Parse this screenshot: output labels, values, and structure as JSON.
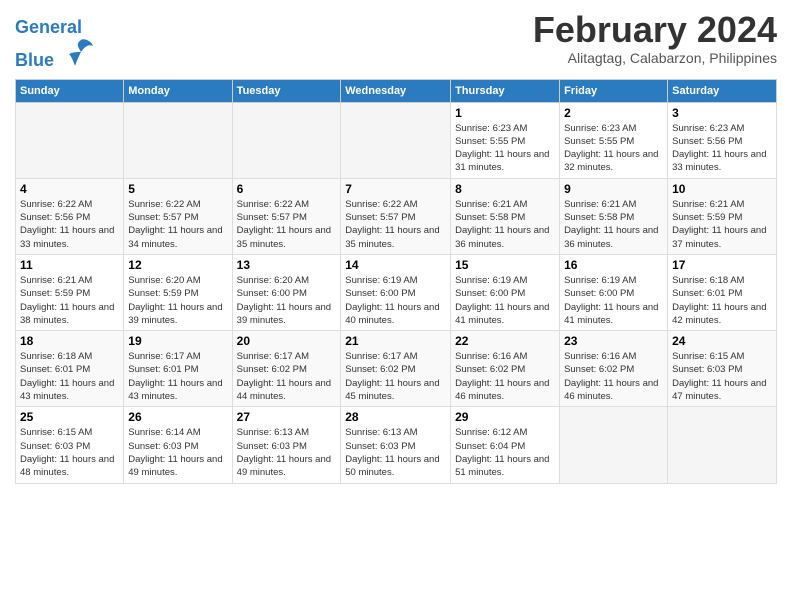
{
  "header": {
    "logo_line1": "General",
    "logo_line2": "Blue",
    "month": "February 2024",
    "location": "Alitagtag, Calabarzon, Philippines"
  },
  "days_of_week": [
    "Sunday",
    "Monday",
    "Tuesday",
    "Wednesday",
    "Thursday",
    "Friday",
    "Saturday"
  ],
  "weeks": [
    [
      {
        "day": "",
        "info": ""
      },
      {
        "day": "",
        "info": ""
      },
      {
        "day": "",
        "info": ""
      },
      {
        "day": "",
        "info": ""
      },
      {
        "day": "1",
        "info": "Sunrise: 6:23 AM\nSunset: 5:55 PM\nDaylight: 11 hours and 31 minutes."
      },
      {
        "day": "2",
        "info": "Sunrise: 6:23 AM\nSunset: 5:55 PM\nDaylight: 11 hours and 32 minutes."
      },
      {
        "day": "3",
        "info": "Sunrise: 6:23 AM\nSunset: 5:56 PM\nDaylight: 11 hours and 33 minutes."
      }
    ],
    [
      {
        "day": "4",
        "info": "Sunrise: 6:22 AM\nSunset: 5:56 PM\nDaylight: 11 hours and 33 minutes."
      },
      {
        "day": "5",
        "info": "Sunrise: 6:22 AM\nSunset: 5:57 PM\nDaylight: 11 hours and 34 minutes."
      },
      {
        "day": "6",
        "info": "Sunrise: 6:22 AM\nSunset: 5:57 PM\nDaylight: 11 hours and 35 minutes."
      },
      {
        "day": "7",
        "info": "Sunrise: 6:22 AM\nSunset: 5:57 PM\nDaylight: 11 hours and 35 minutes."
      },
      {
        "day": "8",
        "info": "Sunrise: 6:21 AM\nSunset: 5:58 PM\nDaylight: 11 hours and 36 minutes."
      },
      {
        "day": "9",
        "info": "Sunrise: 6:21 AM\nSunset: 5:58 PM\nDaylight: 11 hours and 36 minutes."
      },
      {
        "day": "10",
        "info": "Sunrise: 6:21 AM\nSunset: 5:59 PM\nDaylight: 11 hours and 37 minutes."
      }
    ],
    [
      {
        "day": "11",
        "info": "Sunrise: 6:21 AM\nSunset: 5:59 PM\nDaylight: 11 hours and 38 minutes."
      },
      {
        "day": "12",
        "info": "Sunrise: 6:20 AM\nSunset: 5:59 PM\nDaylight: 11 hours and 39 minutes."
      },
      {
        "day": "13",
        "info": "Sunrise: 6:20 AM\nSunset: 6:00 PM\nDaylight: 11 hours and 39 minutes."
      },
      {
        "day": "14",
        "info": "Sunrise: 6:19 AM\nSunset: 6:00 PM\nDaylight: 11 hours and 40 minutes."
      },
      {
        "day": "15",
        "info": "Sunrise: 6:19 AM\nSunset: 6:00 PM\nDaylight: 11 hours and 41 minutes."
      },
      {
        "day": "16",
        "info": "Sunrise: 6:19 AM\nSunset: 6:00 PM\nDaylight: 11 hours and 41 minutes."
      },
      {
        "day": "17",
        "info": "Sunrise: 6:18 AM\nSunset: 6:01 PM\nDaylight: 11 hours and 42 minutes."
      }
    ],
    [
      {
        "day": "18",
        "info": "Sunrise: 6:18 AM\nSunset: 6:01 PM\nDaylight: 11 hours and 43 minutes."
      },
      {
        "day": "19",
        "info": "Sunrise: 6:17 AM\nSunset: 6:01 PM\nDaylight: 11 hours and 43 minutes."
      },
      {
        "day": "20",
        "info": "Sunrise: 6:17 AM\nSunset: 6:02 PM\nDaylight: 11 hours and 44 minutes."
      },
      {
        "day": "21",
        "info": "Sunrise: 6:17 AM\nSunset: 6:02 PM\nDaylight: 11 hours and 45 minutes."
      },
      {
        "day": "22",
        "info": "Sunrise: 6:16 AM\nSunset: 6:02 PM\nDaylight: 11 hours and 46 minutes."
      },
      {
        "day": "23",
        "info": "Sunrise: 6:16 AM\nSunset: 6:02 PM\nDaylight: 11 hours and 46 minutes."
      },
      {
        "day": "24",
        "info": "Sunrise: 6:15 AM\nSunset: 6:03 PM\nDaylight: 11 hours and 47 minutes."
      }
    ],
    [
      {
        "day": "25",
        "info": "Sunrise: 6:15 AM\nSunset: 6:03 PM\nDaylight: 11 hours and 48 minutes."
      },
      {
        "day": "26",
        "info": "Sunrise: 6:14 AM\nSunset: 6:03 PM\nDaylight: 11 hours and 49 minutes."
      },
      {
        "day": "27",
        "info": "Sunrise: 6:13 AM\nSunset: 6:03 PM\nDaylight: 11 hours and 49 minutes."
      },
      {
        "day": "28",
        "info": "Sunrise: 6:13 AM\nSunset: 6:03 PM\nDaylight: 11 hours and 50 minutes."
      },
      {
        "day": "29",
        "info": "Sunrise: 6:12 AM\nSunset: 6:04 PM\nDaylight: 11 hours and 51 minutes."
      },
      {
        "day": "",
        "info": ""
      },
      {
        "day": "",
        "info": ""
      }
    ]
  ]
}
